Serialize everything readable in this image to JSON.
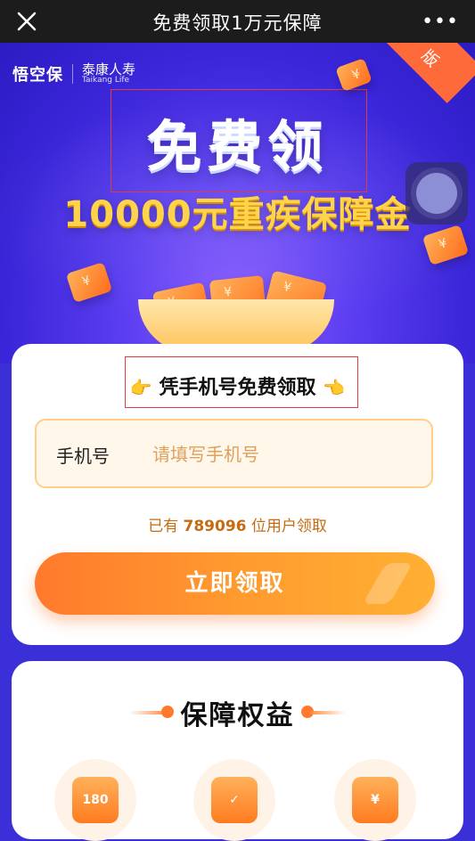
{
  "topbar": {
    "title": "免费领取1万元保障",
    "close_icon": "close-icon",
    "more_icon": "more-horizontal-icon",
    "more_glyph": "•••"
  },
  "hero": {
    "brand_left": "悟空保",
    "brand_right_cn": "泰康人寿",
    "brand_right_en": "Taikang Life",
    "title": "免费领",
    "subtitle": "10000元重疾保障金",
    "ribbon_text": "版"
  },
  "signup": {
    "heading": "凭手机号免费领取",
    "phone_label": "手机号",
    "phone_placeholder": "请填写手机号",
    "count_prefix": "已有",
    "count_number": "789096",
    "count_suffix": "位用户领取",
    "cta_label": "立即领取"
  },
  "benefits": {
    "heading": "保障权益",
    "items": [
      {
        "icon": "calendar-180-icon",
        "text": "180"
      },
      {
        "icon": "shield-check-icon",
        "text": ""
      },
      {
        "icon": "card-yuan-icon",
        "text": ""
      }
    ]
  },
  "colors": {
    "hero_bg": "#3a25d8",
    "accent_orange": "#ff7a2c",
    "gold": "#ffd44a"
  }
}
